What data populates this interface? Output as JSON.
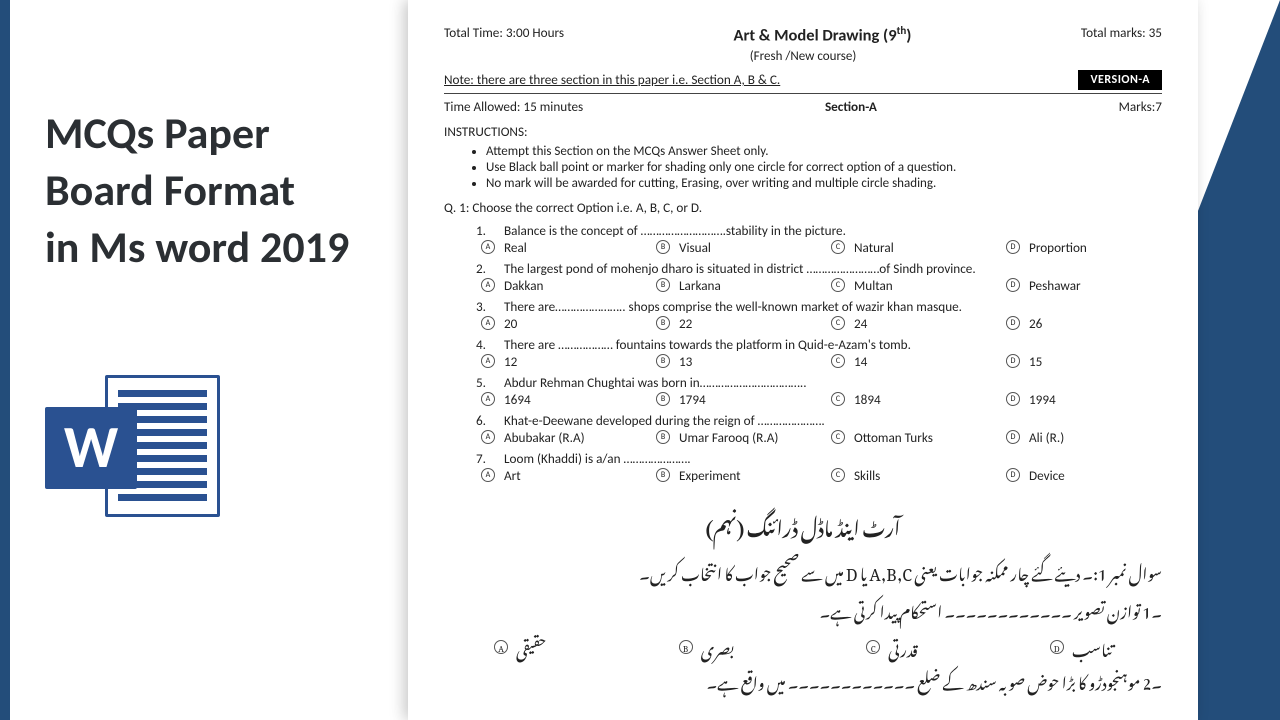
{
  "left_title": {
    "l1": "MCQs Paper",
    "l2": "Board Format",
    "l3": "in Ms word 2019"
  },
  "doc": {
    "total_time": "Total Time: 3:00 Hours",
    "title": "Art & Model Drawing (9",
    "title_sup": "th",
    "title_close": ")",
    "total_marks": "Total marks: 35",
    "subtitle": "(Fresh /New course)",
    "note": "Note: there are three section in this paper i.e. Section A, B & C.",
    "version": "VERSION-A",
    "time_allowed": "Time Allowed:  15 minutes",
    "section": "Section-A",
    "marks": "Marks:7",
    "instr_label": "INSTRUCTIONS:",
    "instructions": [
      "Attempt this Section on the MCQs Answer Sheet only.",
      "Use Black ball point or marker for shading only one circle for correct option of a question.",
      "No mark will be awarded for cutting, Erasing, over writing and multiple circle shading."
    ],
    "q1": "Q. 1:    Choose the correct Option i.e. A, B, C, or D.",
    "letters": [
      "A",
      "B",
      "C",
      "D"
    ],
    "questions": [
      {
        "n": "1.",
        "t": "Balance is the concept of ……………………….stability in the picture.",
        "o": [
          "Real",
          "Visual",
          "Natural",
          "Proportion"
        ]
      },
      {
        "n": "2.",
        "t": "The largest pond of mohenjo dharo is situated in district ……………………of Sindh province.",
        "o": [
          "Dakkan",
          "Larkana",
          "Multan",
          "Peshawar"
        ]
      },
      {
        "n": "3.",
        "t": "There are………………….. shops comprise the well-known market of wazir khan masque.",
        "o": [
          "20",
          "22",
          "24",
          "26"
        ]
      },
      {
        "n": "4.",
        "t": "There are ……………… fountains towards the platform in Quid-e-Azam's tomb.",
        "o": [
          "12",
          "13",
          "14",
          "15"
        ]
      },
      {
        "n": "5.",
        "t": "Abdur Rehman Chughtai was born in……………………………..",
        "o": [
          "1694",
          "1794",
          "1894",
          "1994"
        ]
      },
      {
        "n": "6.",
        "t": "Khat-e-Deewane developed during the reign of ………………….",
        "o": [
          "Abubakar (R.A)",
          "Umar Farooq (R.A)",
          "Ottoman Turks",
          "Ali (R.)"
        ]
      },
      {
        "n": "7.",
        "t": "Loom (Khaddi) is a/an ………………….",
        "o": [
          "Art",
          "Experiment",
          "Skills",
          "Device"
        ]
      }
    ],
    "urdu": {
      "title": "آرٹ اینڈ ماڈل ڈرائنگ (نہم)",
      "q1": "سوال نمبر 1:۔   دیئے گئے چار ممکنہ جوابات یعنی A,B,C یا D میں سے صحیح جواب کا انتخاب کریں۔",
      "r1": "۔1        توازن تصویر ۔۔۔۔۔۔۔۔۔۔۔۔ استحکام پیدا کرتی ہے۔",
      "o1": [
        "حقیقی",
        "بصری",
        "قدرتی",
        "تناسب"
      ],
      "r2": "۔2        موہنجودڑو کا بڑا حوض صوبہ سندھ کے ضلع ۔۔۔۔۔۔۔۔۔۔۔۔ میں واقع ہے۔"
    }
  }
}
